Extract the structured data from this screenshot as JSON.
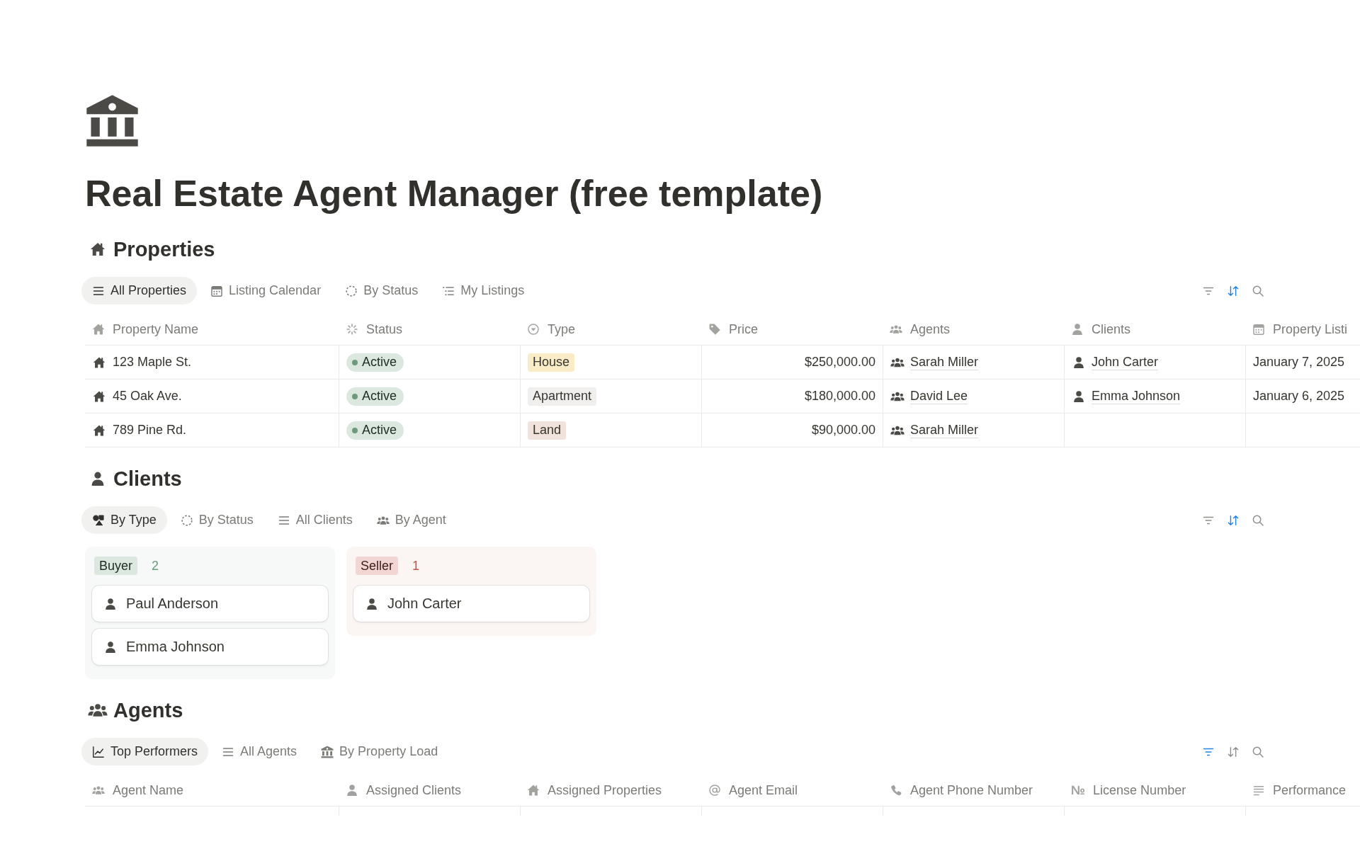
{
  "page": {
    "title": "Real Estate Agent Manager (free template)"
  },
  "sections": [
    {
      "kind": "table",
      "heading": "Properties",
      "views": [
        {
          "label": "All Properties",
          "selected": true
        },
        {
          "label": "Listing Calendar",
          "selected": false
        },
        {
          "label": "By Status",
          "selected": false
        },
        {
          "label": "My Listings",
          "selected": false
        }
      ],
      "toolbar": {
        "filter_on": false,
        "sort_on": true
      },
      "table": {
        "columns": [
          {
            "label": "Property Name",
            "kind": "title"
          },
          {
            "label": "Status",
            "kind": "status"
          },
          {
            "label": "Type",
            "kind": "select"
          },
          {
            "label": "Price",
            "kind": "number"
          },
          {
            "label": "Agents",
            "kind": "relation"
          },
          {
            "label": "Clients",
            "kind": "relation"
          },
          {
            "label": "Property Listi",
            "kind": "date"
          }
        ],
        "rows": [
          {
            "cells": [
              "123 Maple St.",
              {
                "label": "Active",
                "color": "#6c9b7d"
              },
              {
                "label": "House",
                "color": "#fbecc8"
              },
              "$250,000.00",
              [
                "Sarah Miller"
              ],
              [
                "John Carter"
              ],
              "January 7, 2025"
            ]
          },
          {
            "cells": [
              "45 Oak Ave.",
              {
                "label": "Active",
                "color": "#6c9b7d"
              },
              {
                "label": "Apartment",
                "color": "#f0efed"
              },
              "$180,000.00",
              [
                "David Lee"
              ],
              [
                "Emma Johnson"
              ],
              "January 6, 2025"
            ]
          },
          {
            "cells": [
              "789 Pine Rd.",
              {
                "label": "Active",
                "color": "#6c9b7d"
              },
              {
                "label": "Land",
                "color": "#f1e2dc"
              },
              "$90,000.00",
              [
                "Sarah Miller"
              ]
            ]
          }
        ]
      }
    },
    {
      "kind": "board",
      "heading": "Clients",
      "views": [
        {
          "label": "By Type",
          "selected": true
        },
        {
          "label": "By Status",
          "selected": false
        },
        {
          "label": "All Clients",
          "selected": false
        },
        {
          "label": "By Agent",
          "selected": false
        }
      ],
      "toolbar": {
        "filter_on": false,
        "sort_on": true
      },
      "board": {
        "groups": [
          {
            "label": "Buyer",
            "count": "2",
            "color": "#6c9b7d",
            "cards": [
              "Paul Anderson",
              "Emma Johnson"
            ]
          },
          {
            "label": "Seller",
            "count": "1",
            "color": "#c4554d",
            "cards": [
              "John Carter"
            ]
          }
        ]
      }
    },
    {
      "kind": "table",
      "heading": "Agents",
      "views": [
        {
          "label": "Top Performers",
          "selected": true
        },
        {
          "label": "All Agents",
          "selected": false
        },
        {
          "label": "By Property Load",
          "selected": false
        }
      ],
      "toolbar": {
        "filter_on": true,
        "sort_on": false
      },
      "table": {
        "columns": [
          {
            "label": "Agent Name"
          },
          {
            "label": "Assigned Clients"
          },
          {
            "label": "Assigned Properties"
          },
          {
            "label": "Agent Email"
          },
          {
            "label": "Agent Phone Number"
          },
          {
            "label": "License Number",
            "symbol": "№"
          },
          {
            "label": "Performance"
          }
        ]
      }
    }
  ]
}
